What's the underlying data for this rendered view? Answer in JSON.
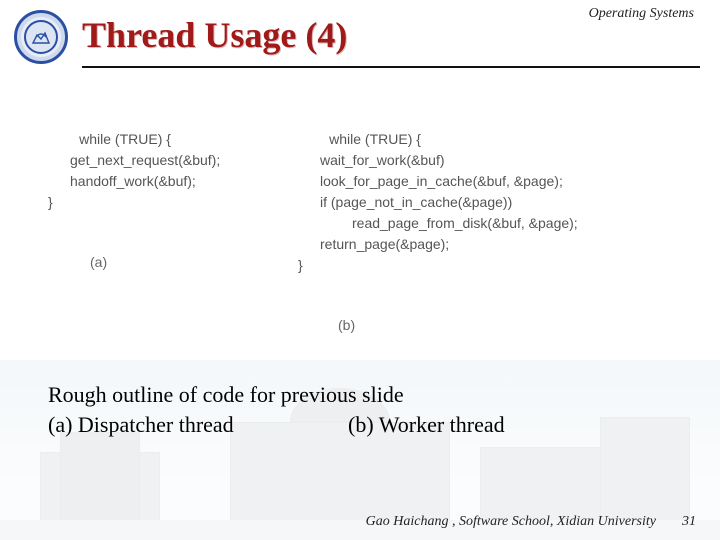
{
  "header": {
    "course_label": "Operating Systems",
    "title": "Thread Usage (4)"
  },
  "code": {
    "a": {
      "line1": "while (TRUE) {",
      "line2": "get_next_request(&buf);",
      "line3": "handoff_work(&buf);",
      "line4": "}",
      "label": "(a)"
    },
    "b": {
      "line1": "while (TRUE) {",
      "line2": "wait_for_work(&buf)",
      "line3": "look_for_page_in_cache(&buf, &page);",
      "line4": "if (page_not_in_cache(&page))",
      "line5": "read_page_from_disk(&buf, &page);",
      "line6": "return_page(&page);",
      "line7": "}",
      "label": "(b)"
    }
  },
  "caption": {
    "intro": "Rough outline of code for previous slide",
    "a": " (a) Dispatcher thread",
    "b": "(b) Worker thread"
  },
  "footer": {
    "credit": "Gao Haichang , Software School, Xidian University",
    "page": "31"
  }
}
